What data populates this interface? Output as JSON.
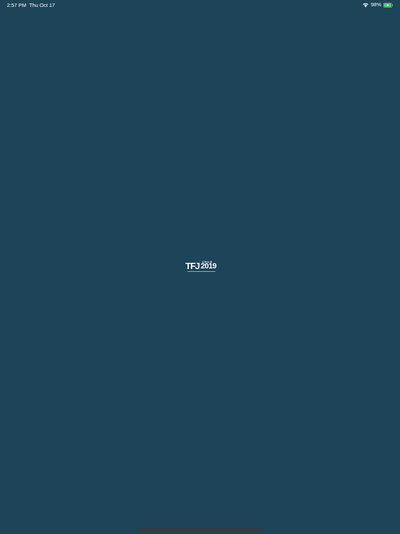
{
  "colors": {
    "background": "#1d4459",
    "battery_fill": "#4cd964",
    "home_indicator": "#3a3a3a"
  },
  "status_bar": {
    "time": "2:57 PM",
    "date": "Thu Oct 17",
    "battery_percent": "98%",
    "battery_level": 0.98,
    "wifi_icon": "wifi-icon",
    "battery_icon": "battery-charging-icon"
  },
  "splash": {
    "logo_mark": "TFJ",
    "logo_country": "CHILE",
    "logo_year": "2019"
  }
}
